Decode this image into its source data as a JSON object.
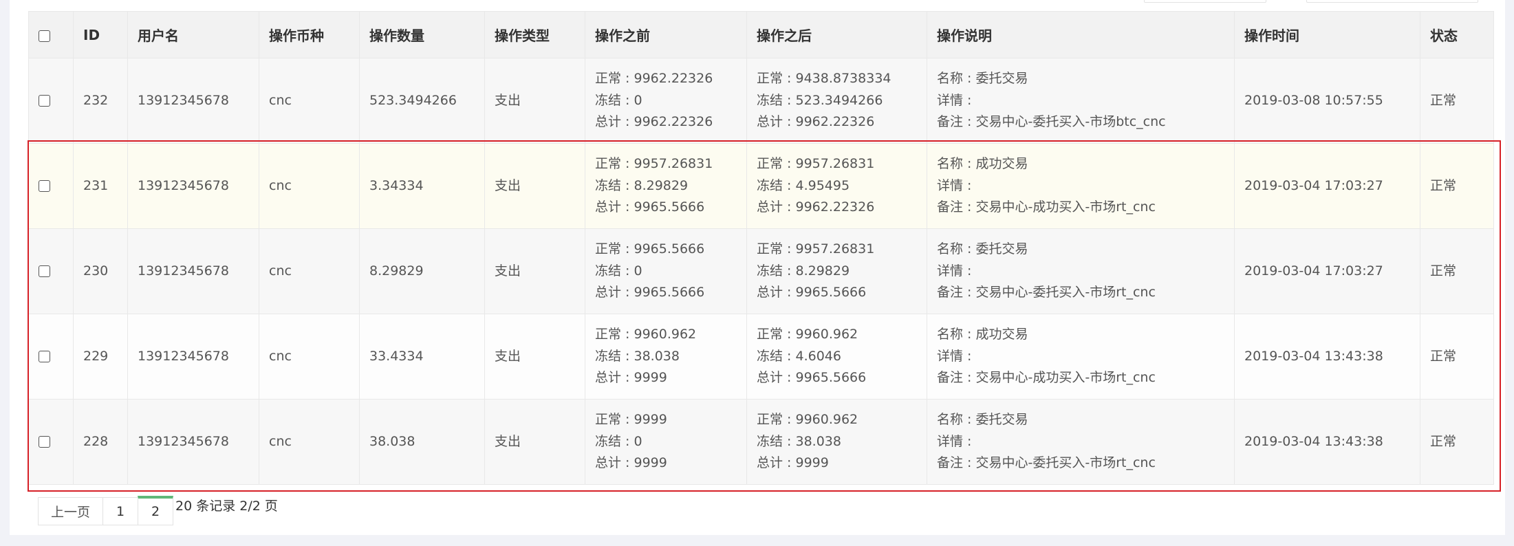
{
  "table": {
    "headers": [
      "ID",
      "用户名",
      "操作币种",
      "操作数量",
      "操作类型",
      "操作之前",
      "操作之后",
      "操作说明",
      "操作时间",
      "状态"
    ],
    "rows": [
      {
        "id": "232",
        "username": "13912345678",
        "coin": "cnc",
        "amount": "523.3494266",
        "type": "支出",
        "before": [
          "正常 : 9962.22326",
          "冻结 : 0",
          "总计 : 9962.22326"
        ],
        "after": [
          "正常 : 9438.8738334",
          "冻结 : 523.3494266",
          "总计 : 9962.22326"
        ],
        "desc": [
          "名称 : 委托交易",
          "详情 :",
          "备注 : 交易中心-委托买入-市场btc_cnc"
        ],
        "time": "2019-03-08 10:57:55",
        "status": "正常"
      },
      {
        "id": "231",
        "username": "13912345678",
        "coin": "cnc",
        "amount": "3.34334",
        "type": "支出",
        "before": [
          "正常 : 9957.26831",
          "冻结 : 8.29829",
          "总计 : 9965.5666"
        ],
        "after": [
          "正常 : 9957.26831",
          "冻结 : 4.95495",
          "总计 : 9962.22326"
        ],
        "desc": [
          "名称 : 成功交易",
          "详情 :",
          "备注 : 交易中心-成功买入-市场rt_cnc"
        ],
        "time": "2019-03-04 17:03:27",
        "status": "正常"
      },
      {
        "id": "230",
        "username": "13912345678",
        "coin": "cnc",
        "amount": "8.29829",
        "type": "支出",
        "before": [
          "正常 : 9965.5666",
          "冻结 : 0",
          "总计 : 9965.5666"
        ],
        "after": [
          "正常 : 9957.26831",
          "冻结 : 8.29829",
          "总计 : 9965.5666"
        ],
        "desc": [
          "名称 : 委托交易",
          "详情 :",
          "备注 : 交易中心-委托买入-市场rt_cnc"
        ],
        "time": "2019-03-04 17:03:27",
        "status": "正常"
      },
      {
        "id": "229",
        "username": "13912345678",
        "coin": "cnc",
        "amount": "33.4334",
        "type": "支出",
        "before": [
          "正常 : 9960.962",
          "冻结 : 38.038",
          "总计 : 9999"
        ],
        "after": [
          "正常 : 9960.962",
          "冻结 : 4.6046",
          "总计 : 9965.5666"
        ],
        "desc": [
          "名称 : 成功交易",
          "详情 :",
          "备注 : 交易中心-成功买入-市场rt_cnc"
        ],
        "time": "2019-03-04 13:43:38",
        "status": "正常"
      },
      {
        "id": "228",
        "username": "13912345678",
        "coin": "cnc",
        "amount": "38.038",
        "type": "支出",
        "before": [
          "正常 : 9999",
          "冻结 : 0",
          "总计 : 9999"
        ],
        "after": [
          "正常 : 9960.962",
          "冻结 : 38.038",
          "总计 : 9999"
        ],
        "desc": [
          "名称 : 委托交易",
          "详情 :",
          "备注 : 交易中心-委托买入-市场rt_cnc"
        ],
        "time": "2019-03-04 13:43:38",
        "status": "正常"
      }
    ]
  },
  "pagination": {
    "prev_label": "上一页",
    "pages": [
      "1",
      "2"
    ],
    "current_page": "2",
    "summary": "20 条记录 2/2 页"
  },
  "colors": {
    "highlight_border": "#d62027",
    "pager_active": "#5fb878",
    "hover_row": "#fdfcf1"
  }
}
